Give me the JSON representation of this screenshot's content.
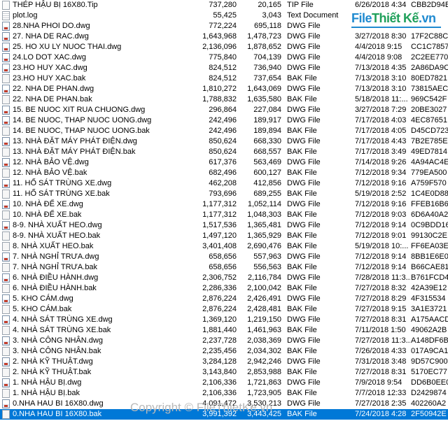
{
  "files": [
    {
      "icon": "tip-file-icon",
      "name": "THÉP HẬU BỊ 16X80.Tip",
      "csize": "737,280",
      "usize": "20,165",
      "type": "TIP File",
      "date": "6/26/2018 4:34",
      "crc": "CBB2D94B"
    },
    {
      "icon": "text-file-icon",
      "name": "plot.log",
      "csize": "55,425",
      "usize": "3,043",
      "type": "Text Document",
      "date": "",
      "crc": ""
    },
    {
      "icon": "dwg-file-icon",
      "name": "28.NHA PHOI DO.dwg",
      "csize": "772,224",
      "usize": "695,118",
      "type": "DWG File",
      "date": "",
      "crc": ""
    },
    {
      "icon": "dwg-file-icon",
      "name": "27. NHA DE RAC.dwg",
      "csize": "1,643,968",
      "usize": "1,478,723",
      "type": "DWG File",
      "date": "3/27/2018 8:30",
      "crc": "17F2C88C"
    },
    {
      "icon": "dwg-file-icon",
      "name": "25. HO XU LY NUOC THAI.dwg",
      "csize": "2,136,096",
      "usize": "1,878,652",
      "type": "DWG File",
      "date": "4/4/2018 9:15",
      "crc": "CC1C7857"
    },
    {
      "icon": "dwg-file-icon",
      "name": "24.LO DOT  XAC.dwg",
      "csize": "775,840",
      "usize": "704,139",
      "type": "DWG File",
      "date": "4/4/2018 9:08",
      "crc": "2C2EE770"
    },
    {
      "icon": "dwg-file-icon",
      "name": "23.HO HUY XAC.dwg",
      "csize": "824,512",
      "usize": "736,940",
      "type": "DWG File",
      "date": "7/13/2018 4:35",
      "crc": "2A86DA9C"
    },
    {
      "icon": "bak-file-icon",
      "name": "23.HO HUY XAC.bak",
      "csize": "824,512",
      "usize": "737,654",
      "type": "BAK File",
      "date": "7/13/2018 3:10",
      "crc": "80ED7821"
    },
    {
      "icon": "dwg-file-icon",
      "name": "22. NHA DE PHAN.dwg",
      "csize": "1,810,272",
      "usize": "1,643,069",
      "type": "DWG File",
      "date": "7/13/2018 3:10",
      "crc": "73815AEC"
    },
    {
      "icon": "bak-file-icon",
      "name": "22. NHA DE PHAN.bak",
      "csize": "1,788,832",
      "usize": "1,635,580",
      "type": "BAK File",
      "date": "5/18/2018 11:...",
      "crc": "969C542F"
    },
    {
      "icon": "dwg-file-icon",
      "name": "15. BE NUOC XIT RUA CHUONG.dwg",
      "csize": "296,864",
      "usize": "227,084",
      "type": "DWG File",
      "date": "3/27/2018 7:29",
      "crc": "20BE3027"
    },
    {
      "icon": "dwg-file-icon",
      "name": "14. BE NUOC, THAP NUOC UONG.dwg",
      "csize": "242,496",
      "usize": "189,917",
      "type": "DWG File",
      "date": "7/17/2018 4:03",
      "crc": "4EC87651"
    },
    {
      "icon": "bak-file-icon",
      "name": "14. BE NUOC, THAP NUOC UONG.bak",
      "csize": "242,496",
      "usize": "189,894",
      "type": "BAK File",
      "date": "7/17/2018 4:05",
      "crc": "D45CD723"
    },
    {
      "icon": "dwg-file-icon",
      "name": "13. NHÀ ĐẶT MÁY PHÁT ĐIỆN.dwg",
      "csize": "850,624",
      "usize": "668,330",
      "type": "DWG File",
      "date": "7/17/2018 4:43",
      "crc": "7B2E785E"
    },
    {
      "icon": "bak-file-icon",
      "name": "13. NHÀ ĐẶT MÁY PHÁT ĐIỆN.bak",
      "csize": "850,624",
      "usize": "668,557",
      "type": "BAK File",
      "date": "7/17/2018 3:49",
      "crc": "49ED7814"
    },
    {
      "icon": "dwg-file-icon",
      "name": "12. NHÀ BẢO VỆ.dwg",
      "csize": "617,376",
      "usize": "563,469",
      "type": "DWG File",
      "date": "7/14/2018 9:26",
      "crc": "4A94AC4E"
    },
    {
      "icon": "bak-file-icon",
      "name": "12. NHÀ BẢO VỆ.bak",
      "csize": "682,496",
      "usize": "600,127",
      "type": "BAK File",
      "date": "7/12/2018 9:34",
      "crc": "779EA500"
    },
    {
      "icon": "dwg-file-icon",
      "name": "11. HỐ SÁT TRÙNG XE.dwg",
      "csize": "462,208",
      "usize": "412,856",
      "type": "DWG File",
      "date": "7/12/2018 9:16",
      "crc": "A759F570"
    },
    {
      "icon": "bak-file-icon",
      "name": "11. HỐ SÁT TRÙNG XE.bak",
      "csize": "793,696",
      "usize": "689,255",
      "type": "BAK File",
      "date": "5/19/2018 2:52",
      "crc": "1C4E0D88"
    },
    {
      "icon": "dwg-file-icon",
      "name": "10. NHÀ ĐỂ XE.dwg",
      "csize": "1,177,312",
      "usize": "1,052,114",
      "type": "DWG File",
      "date": "7/12/2018 9:16",
      "crc": "FFEB16B6"
    },
    {
      "icon": "bak-file-icon",
      "name": "10. NHÀ ĐỂ XE.bak",
      "csize": "1,177,312",
      "usize": "1,048,303",
      "type": "BAK File",
      "date": "7/12/2018 9:03",
      "crc": "6D6A40A2"
    },
    {
      "icon": "dwg-file-icon",
      "name": "8-9. NHÀ XUẤT HEO.dwg",
      "csize": "1,517,536",
      "usize": "1,365,481",
      "type": "DWG File",
      "date": "7/12/2018 9:14",
      "crc": "0C9BDD16"
    },
    {
      "icon": "bak-file-icon",
      "name": "8-9. NHÀ XUẤT HEO.bak",
      "csize": "1,497,120",
      "usize": "1,365,929",
      "type": "BAK File",
      "date": "7/12/2018 9:01",
      "crc": "99130C2E"
    },
    {
      "icon": "bak-file-icon",
      "name": "8. NHÀ XUẤT HEO.bak",
      "csize": "3,401,408",
      "usize": "2,690,476",
      "type": "BAK File",
      "date": "5/19/2018 10:...",
      "crc": "FF6EA03E"
    },
    {
      "icon": "dwg-file-icon",
      "name": "7. NHÀ NGHỈ TRƯA.dwg",
      "csize": "658,656",
      "usize": "557,963",
      "type": "DWG File",
      "date": "7/12/2018 9:14",
      "crc": "8BB1E6E0"
    },
    {
      "icon": "bak-file-icon",
      "name": "7. NHÀ NGHỈ TRƯA.bak",
      "csize": "658,656",
      "usize": "556,563",
      "type": "BAK File",
      "date": "7/12/2018 9:14",
      "crc": "B66CAE81"
    },
    {
      "icon": "dwg-file-icon",
      "name": "6. NHÀ ĐIỀU HÀNH.dwg",
      "csize": "2,306,752",
      "usize": "2,116,784",
      "type": "DWG File",
      "date": "7/28/2018 11:3...",
      "crc": "B761FCD4"
    },
    {
      "icon": "bak-file-icon",
      "name": "6. NHÀ ĐIỀU HÀNH.bak",
      "csize": "2,286,336",
      "usize": "2,100,042",
      "type": "BAK File",
      "date": "7/27/2018 8:32",
      "crc": "42A39E12"
    },
    {
      "icon": "dwg-file-icon",
      "name": "5. KHO CÁM.dwg",
      "csize": "2,876,224",
      "usize": "2,426,491",
      "type": "DWG File",
      "date": "7/27/2018 8:29",
      "crc": "4F315534"
    },
    {
      "icon": "bak-file-icon",
      "name": "5. KHO CÁM.bak",
      "csize": "2,876,224",
      "usize": "2,428,481",
      "type": "BAK File",
      "date": "7/27/2018 9:15",
      "crc": "3A1E3721"
    },
    {
      "icon": "dwg-file-icon",
      "name": "4. NHÀ SÁT TRÙNG XE.dwg",
      "csize": "1,369,120",
      "usize": "1,219,150",
      "type": "DWG File",
      "date": "7/27/2018 8:31",
      "crc": "A175AACD"
    },
    {
      "icon": "bak-file-icon",
      "name": "4. NHÀ SÁT TRÙNG XE.bak",
      "csize": "1,881,440",
      "usize": "1,461,963",
      "type": "BAK File",
      "date": "7/11/2018 1:50",
      "crc": "49062A2B"
    },
    {
      "icon": "dwg-file-icon",
      "name": "3. NHÀ CÔNG NHÂN.dwg",
      "csize": "2,237,728",
      "usize": "2,038,369",
      "type": "DWG File",
      "date": "7/27/2018 11:3...",
      "crc": "A148DF6B"
    },
    {
      "icon": "bak-file-icon",
      "name": "3. NHÀ CÔNG NHÂN.bak",
      "csize": "2,235,456",
      "usize": "2,034,302",
      "type": "BAK File",
      "date": "7/26/2018 4:33",
      "crc": "017A9CA1"
    },
    {
      "icon": "dwg-file-icon",
      "name": "2. NHÀ KỸ THUẬT.dwg",
      "csize": "3,284,128",
      "usize": "2,942,246",
      "type": "DWG File",
      "date": "7/31/2018 3:48",
      "crc": "9D57C900"
    },
    {
      "icon": "bak-file-icon",
      "name": "2. NHÀ KỸ THUẬT.bak",
      "csize": "3,143,840",
      "usize": "2,853,988",
      "type": "BAK File",
      "date": "7/27/2018 8:31",
      "crc": "5170EC77"
    },
    {
      "icon": "dwg-file-icon",
      "name": "1. NHÀ HẬU BỊ.dwg",
      "csize": "2,106,336",
      "usize": "1,721,863",
      "type": "DWG File",
      "date": "7/9/2018 9:54",
      "crc": "DD6B0EE0"
    },
    {
      "icon": "bak-file-icon",
      "name": "1. NHÀ HẬU BỊ.bak",
      "csize": "2,106,336",
      "usize": "1,723,905",
      "type": "BAK File",
      "date": "7/7/2018 12:33",
      "crc": "D2429874"
    },
    {
      "icon": "dwg-file-icon",
      "name": "0.NHA HAU BI 16X80.dwg",
      "csize": "4,091,472",
      "usize": "3,530,213",
      "type": "DWG File",
      "date": "7/27/2018 2:35",
      "crc": "402260A2"
    },
    {
      "icon": "bak-file-icon",
      "name": "0.NHA HAU BI 16X80.bak",
      "csize": "3,991,392",
      "usize": "3,443,425",
      "type": "BAK File",
      "date": "7/24/2018 4:28",
      "crc": "2F50942E",
      "selected": true
    }
  ],
  "logo": {
    "part1": "File",
    "part2": "Thiết Kế",
    "part3": ".vn"
  },
  "watermark": "Copyright © FileThietKe.vn"
}
